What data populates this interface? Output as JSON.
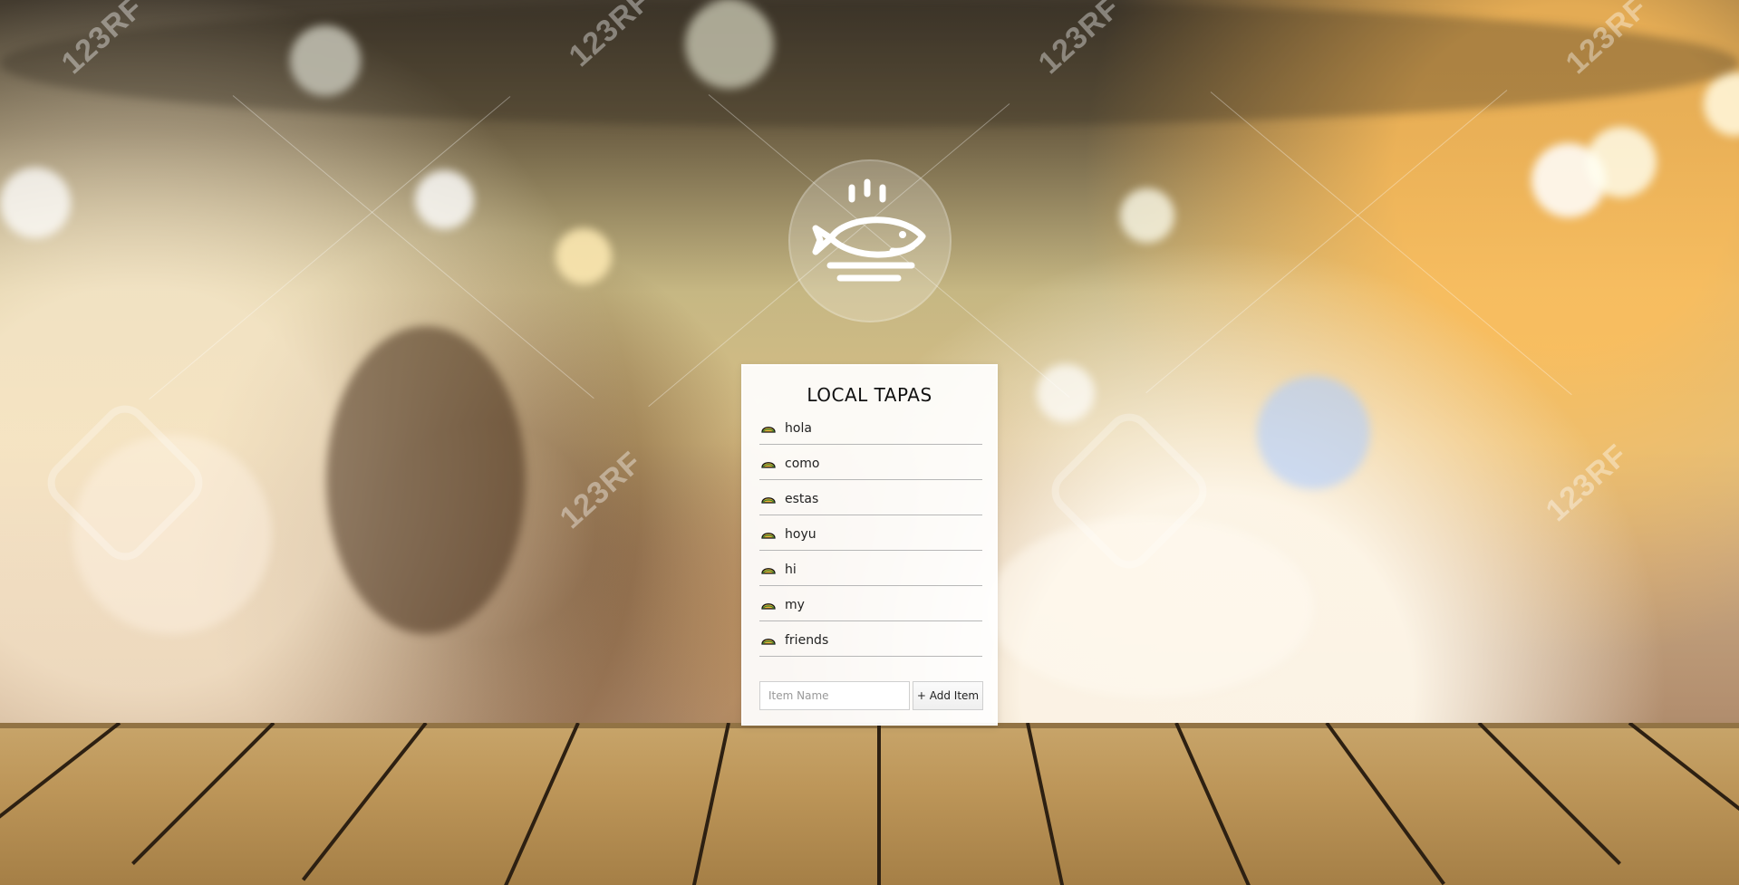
{
  "page": {
    "title": "LOCAL TAPAS"
  },
  "logo": {
    "icon": "fish-icon"
  },
  "list": {
    "items": [
      {
        "label": "hola",
        "icon": "taco-icon"
      },
      {
        "label": "como",
        "icon": "taco-icon"
      },
      {
        "label": "estas",
        "icon": "taco-icon"
      },
      {
        "label": "hoyu",
        "icon": "taco-icon"
      },
      {
        "label": "hi",
        "icon": "taco-icon"
      },
      {
        "label": "my",
        "icon": "taco-icon"
      },
      {
        "label": "friends",
        "icon": "taco-icon"
      }
    ]
  },
  "form": {
    "input_value": "",
    "input_placeholder": "Item Name",
    "add_button_label": "+ Add Item"
  },
  "watermark": {
    "text": "123RF"
  },
  "colors": {
    "card": "#ffffff",
    "text": "#111111"
  }
}
